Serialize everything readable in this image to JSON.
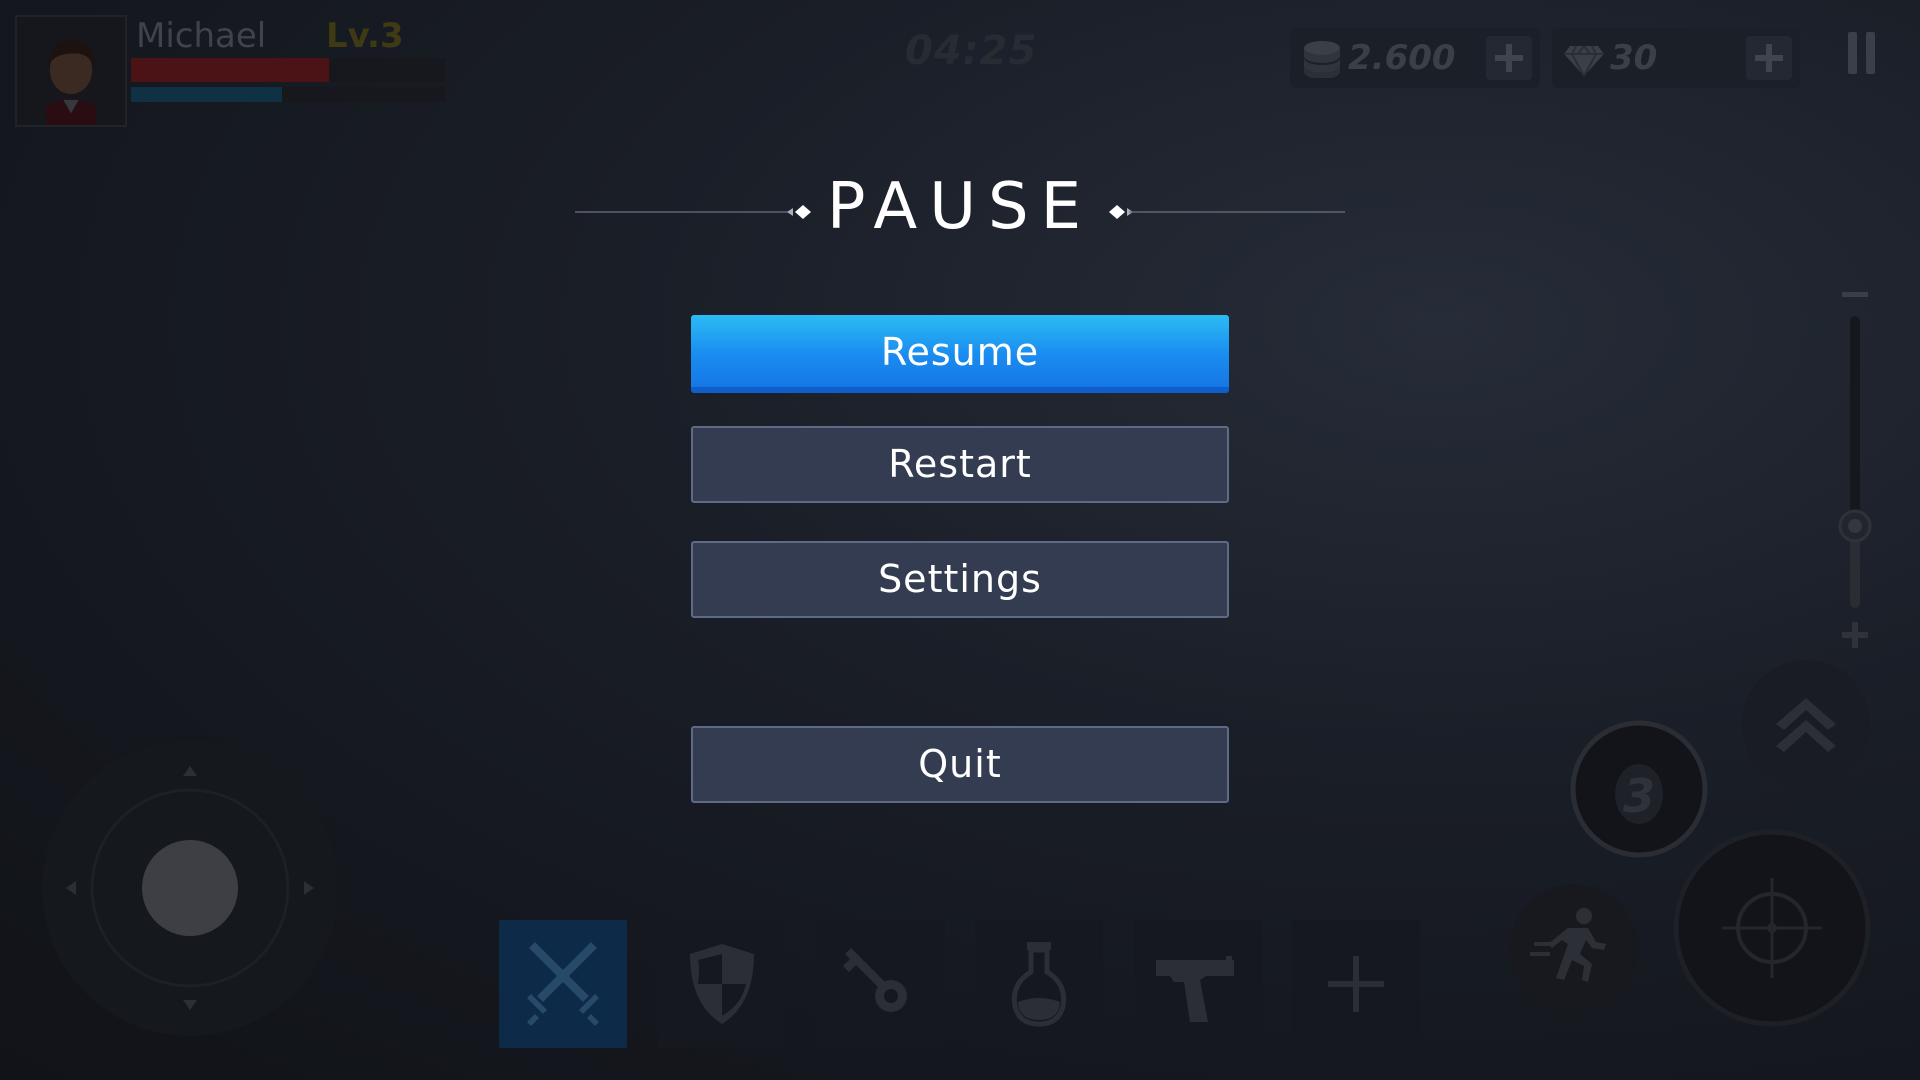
{
  "player": {
    "name": "Michael",
    "level": "Lv.3",
    "hp_fraction": 0.63,
    "mp_fraction": 0.48,
    "hp_color": "#4b1316",
    "mp_color": "#0f3143"
  },
  "timer": "04:25",
  "currency": {
    "coins": {
      "value": "2.600",
      "icon": "coin-stack-icon"
    },
    "gems": {
      "value": "30",
      "icon": "diamond-icon"
    }
  },
  "pause_menu": {
    "title": "PAUSE",
    "buttons": {
      "resume": "Resume",
      "restart": "Restart",
      "settings": "Settings",
      "quit": "Quit"
    },
    "accent_color": "#1a8cf0"
  },
  "item_slots": [
    {
      "id": "attack",
      "icon": "crossed-swords-icon",
      "selected": true
    },
    {
      "id": "shield",
      "icon": "shield-icon",
      "selected": false
    },
    {
      "id": "key",
      "icon": "key-icon",
      "selected": false
    },
    {
      "id": "potion",
      "icon": "potion-flask-icon",
      "selected": false
    },
    {
      "id": "gun",
      "icon": "pistol-icon",
      "selected": false
    },
    {
      "id": "add",
      "icon": "plus-icon",
      "selected": false
    }
  ],
  "grenade_count": "3",
  "zoom_level": 0.3
}
